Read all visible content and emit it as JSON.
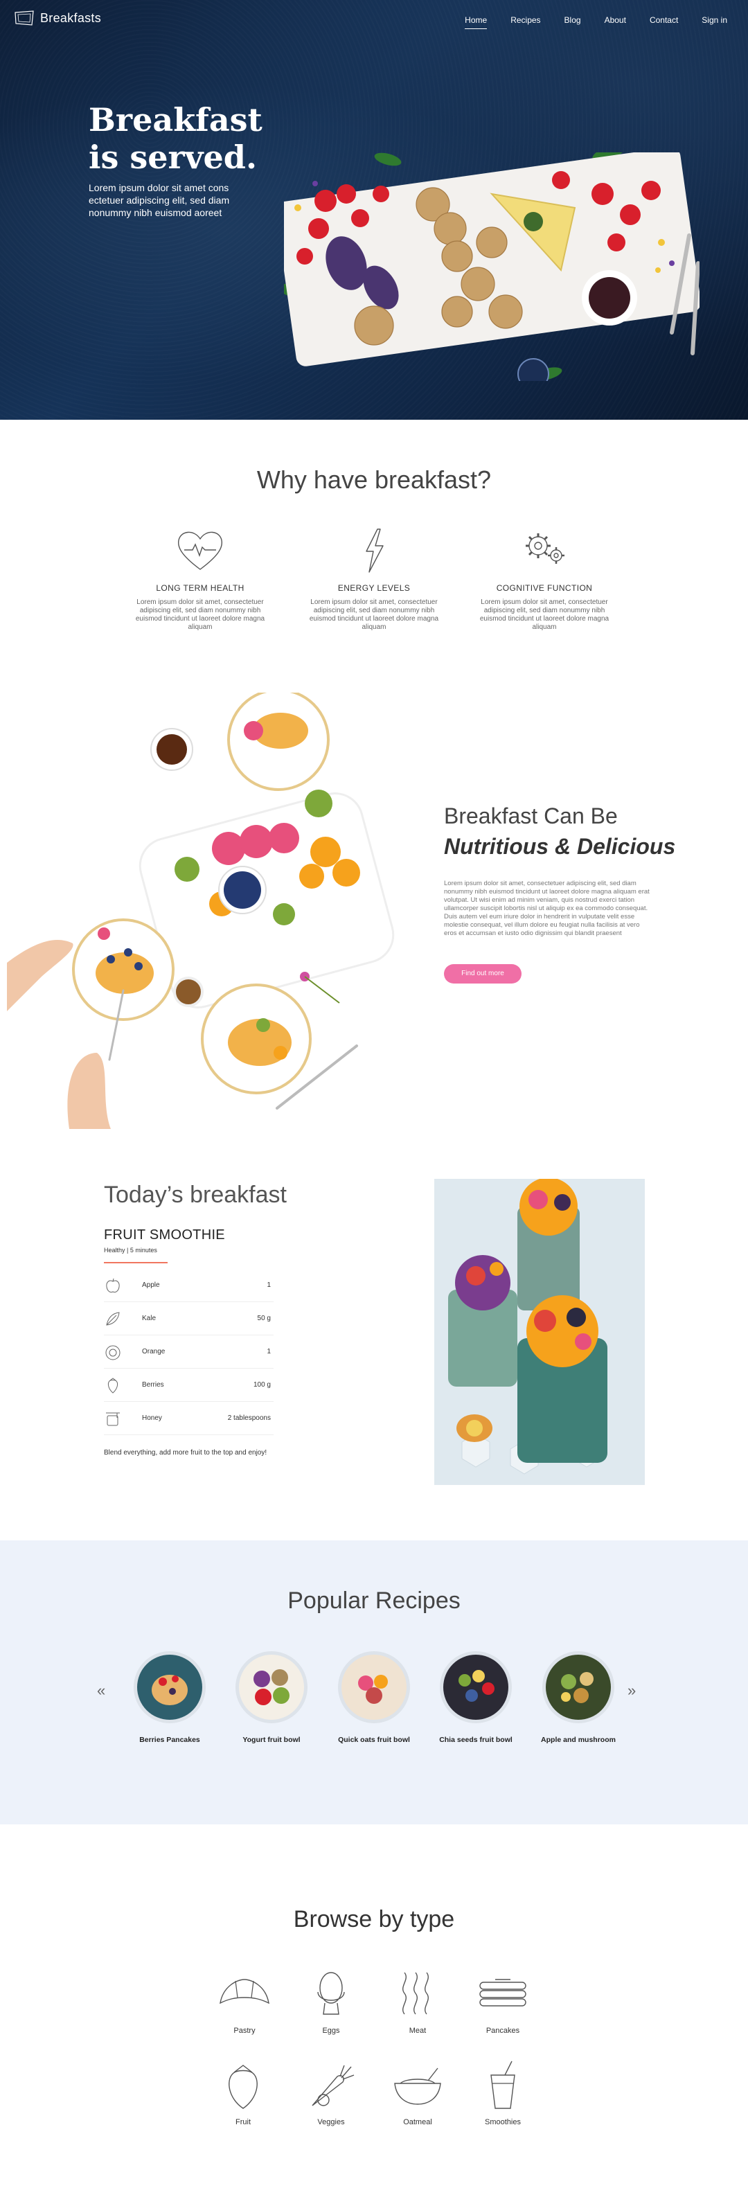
{
  "brand": {
    "name": "Breakfasts"
  },
  "nav": {
    "items": [
      "Home",
      "Recipes",
      "Blog",
      "About",
      "Contact",
      "Sign in"
    ],
    "active": "Home"
  },
  "hero": {
    "title_line1": "Breakfast",
    "title_line2": "is served.",
    "subtitle": "Lorem ipsum dolor sit amet cons ectetuer adipiscing elit, sed diam nonummy nibh euismod aoreet"
  },
  "why": {
    "title": "Why have breakfast?",
    "features": [
      {
        "icon": "heart-icon",
        "title": "LONG TERM HEALTH",
        "text": "Lorem ipsum dolor sit amet, consectetuer adipiscing elit, sed diam nonummy nibh euismod tincidunt ut laoreet dolore magna aliquam"
      },
      {
        "icon": "lightning-icon",
        "title": "ENERGY LEVELS",
        "text": "Lorem ipsum dolor sit amet, consectetuer adipiscing elit, sed diam nonummy nibh euismod tincidunt ut laoreet dolore magna aliquam"
      },
      {
        "icon": "gears-icon",
        "title": "COGNITIVE FUNCTION",
        "text": "Lorem ipsum dolor sit amet, consectetuer adipiscing elit, sed diam nonummy nibh euismod tincidunt ut laoreet dolore magna aliquam"
      }
    ]
  },
  "nutritious": {
    "title_line1": "Breakfast Can Be",
    "title_line2": "Nutritious & Delicious",
    "body": "Lorem ipsum dolor sit amet, consectetuer adipiscing elit, sed diam nonummy nibh euismod tincidunt ut laoreet dolore magna aliquam erat volutpat. Ut wisi enim ad minim veniam, quis nostrud exerci tation ullamcorper suscipit lobortis nisl ut aliquip ex ea commodo consequat. Duis autem vel eum iriure dolor in hendrerit in vulputate velit esse molestie consequat, vel illum dolore eu feugiat nulla facilisis at vero eros et accumsan et iusto odio dignissim qui blandit praesent",
    "button": "Find out more",
    "accent": "#f06fa6"
  },
  "today": {
    "title": "Today’s breakfast",
    "recipe_name": "FRUIT SMOOTHIE",
    "meta": "Healthy | 5 minutes",
    "accent": "#f0765f",
    "ingredients": [
      {
        "icon": "apple-icon",
        "name": "Apple",
        "qty": "1"
      },
      {
        "icon": "kale-icon",
        "name": "Kale",
        "qty": "50 g"
      },
      {
        "icon": "orange-icon",
        "name": "Orange",
        "qty": "1"
      },
      {
        "icon": "strawberry-icon",
        "name": "Berries",
        "qty": "100 g"
      },
      {
        "icon": "honey-icon",
        "name": "Honey",
        "qty": "2 tablespoons"
      }
    ],
    "note": "Blend everything, add more fruit to the top and enjoy!"
  },
  "popular": {
    "title": "Popular Recipes",
    "prev": "«",
    "next": "»",
    "items": [
      {
        "name": "Berries Pancakes"
      },
      {
        "name": "Yogurt fruit bowl"
      },
      {
        "name": "Quick oats fruit bowl"
      },
      {
        "name": "Chia seeds fruit bowl"
      },
      {
        "name": "Apple and mushroom"
      }
    ]
  },
  "browse": {
    "title": "Browse by type",
    "types": [
      {
        "icon": "croissant-icon",
        "name": "Pastry"
      },
      {
        "icon": "egg-icon",
        "name": "Eggs"
      },
      {
        "icon": "bacon-icon",
        "name": "Meat"
      },
      {
        "icon": "pancakes-icon",
        "name": "Pancakes"
      },
      {
        "icon": "strawberry-icon",
        "name": "Fruit"
      },
      {
        "icon": "carrot-icon",
        "name": "Veggies"
      },
      {
        "icon": "bowl-icon",
        "name": "Oatmeal"
      },
      {
        "icon": "smoothie-cup-icon",
        "name": "Smoothies"
      }
    ]
  }
}
